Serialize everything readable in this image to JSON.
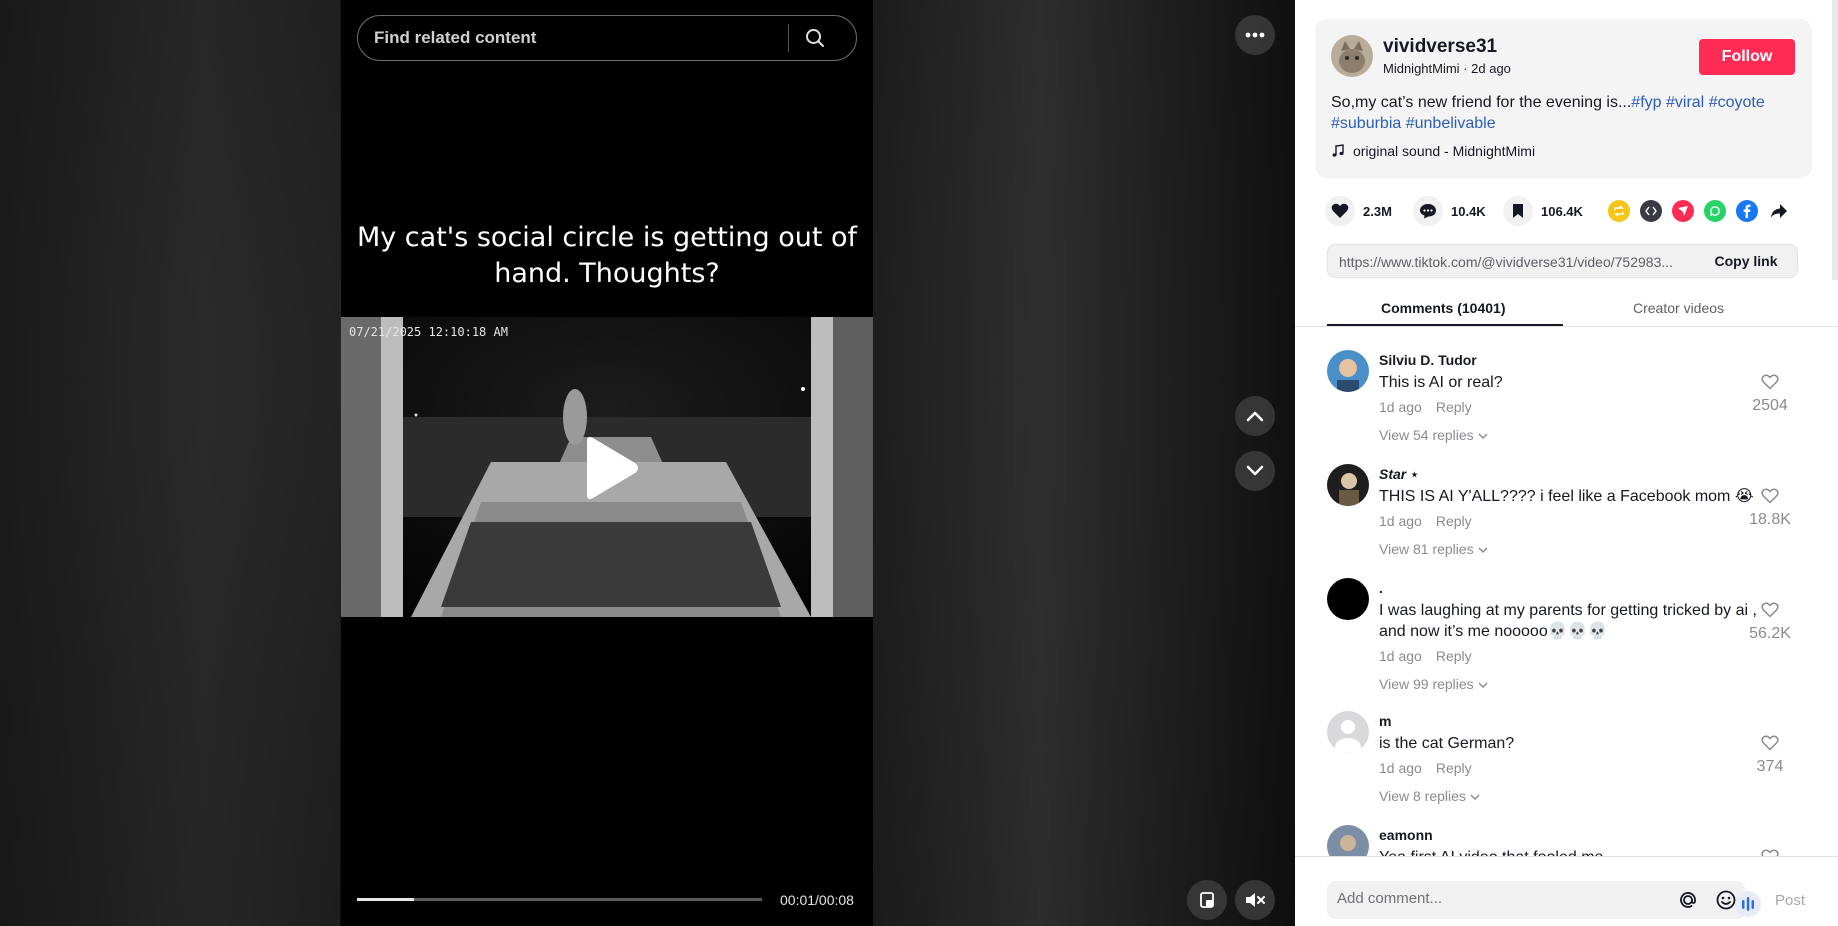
{
  "search": {
    "placeholder": "Find related content"
  },
  "video": {
    "caption": "My cat's social circle is getting out of hand. Thoughts?",
    "timestamp": "07/21/2025 12:10:18 AM",
    "time_display": "00:01/00:08",
    "progress": 0.14
  },
  "author": {
    "username": "vividverse31",
    "nickname": "MidnightMimi",
    "posted": "2d ago",
    "separator": " · ",
    "follow_label": "Follow"
  },
  "post": {
    "text": "So,my cat’s new friend for the evening is...",
    "hashtags": [
      "#fyp",
      "#viral",
      "#coyote",
      "#suburbia",
      "#unbelivable"
    ],
    "music": "original sound - MidnightMimi"
  },
  "stats": {
    "likes": "2.3M",
    "comments": "10.4K",
    "saves": "106.4K"
  },
  "share": {
    "icons": [
      "repost-icon",
      "embed-icon",
      "send-icon",
      "whatsapp-icon",
      "facebook-icon",
      "share-arrow-icon"
    ],
    "colors": {
      "repost": "#f5c518",
      "embed": "#3a3a45",
      "send": "#fe2c55",
      "whatsapp": "#25d366",
      "facebook": "#1877f2"
    }
  },
  "link": {
    "url": "https://www.tiktok.com/@vividverse31/video/752983...",
    "copy_label": "Copy link"
  },
  "tabs": {
    "comments": "Comments (10401)",
    "creator_videos": "Creator videos"
  },
  "comments": [
    {
      "user": "Silviu D. Tudor",
      "text": "This is AI or real?",
      "time": "1d ago",
      "reply": "Reply",
      "replies": "View 54 replies",
      "likes": "2504"
    },
    {
      "user": "Star ⋆",
      "text": "THIS IS AI Y'ALL???? i feel like a Facebook mom 😭",
      "time": "1d ago",
      "reply": "Reply",
      "replies": "View 81 replies",
      "likes": "18.8K"
    },
    {
      "user": ".",
      "text": "I was laughing at my parents for getting tricked by ai , and now it’s me nooooo💀💀💀",
      "time": "1d ago",
      "reply": "Reply",
      "replies": "View 99 replies",
      "likes": "56.2K"
    },
    {
      "user": "m",
      "text": "is the cat German?",
      "time": "1d ago",
      "reply": "Reply",
      "replies": "View 8 replies",
      "likes": "374"
    },
    {
      "user": "eamonn",
      "text": "Yea first AI video that fooled me",
      "time": "",
      "reply": "",
      "replies": "",
      "likes": ""
    }
  ],
  "composer": {
    "placeholder": "Add comment...",
    "post_label": "Post"
  },
  "colors": {
    "accent": "#fe2c55",
    "hashtag": "#2b5db9"
  }
}
